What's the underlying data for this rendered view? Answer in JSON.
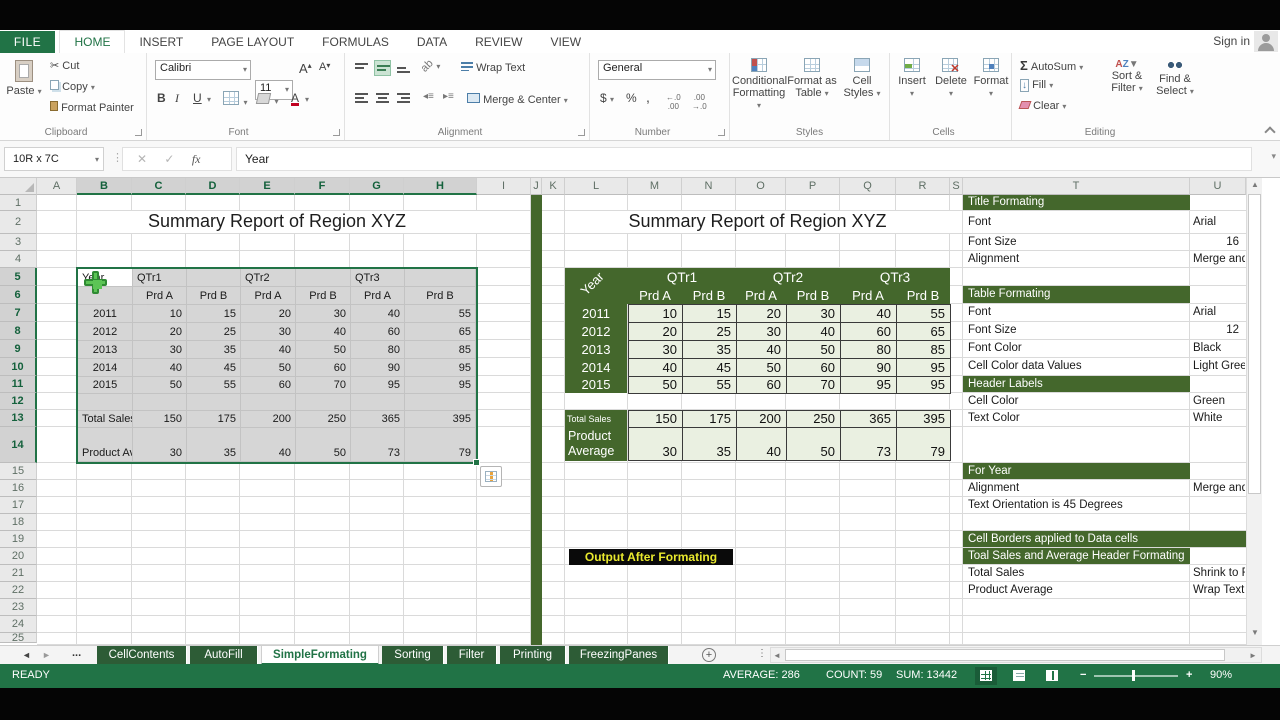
{
  "ribbon_tabs": {
    "file": "FILE",
    "items": [
      "HOME",
      "INSERT",
      "PAGE LAYOUT",
      "FORMULAS",
      "DATA",
      "REVIEW",
      "VIEW"
    ],
    "active": "HOME",
    "sign_in": "Sign in"
  },
  "ribbon": {
    "clipboard": {
      "label": "Clipboard",
      "paste": "Paste",
      "cut": "Cut",
      "copy": "Copy",
      "format_painter": "Format Painter"
    },
    "font": {
      "label": "Font",
      "name": "Calibri",
      "size": "11",
      "bold": "B",
      "italic": "I",
      "underline": "U",
      "grow": "A",
      "shrink": "A",
      "color": "A"
    },
    "alignment": {
      "label": "Alignment",
      "wrap": "Wrap Text",
      "merge": "Merge & Center"
    },
    "number": {
      "label": "Number",
      "format": "General",
      "currency": "$",
      "percent": "%",
      "comma": ",",
      "inc_dec": ".00",
      "dec_dec": ".00"
    },
    "styles": {
      "label": "Styles",
      "conditional_1": "Conditional",
      "conditional_2": "Formatting",
      "format_table_1": "Format as",
      "format_table_2": "Table",
      "cell_styles_1": "Cell",
      "cell_styles_2": "Styles"
    },
    "cells": {
      "label": "Cells",
      "insert": "Insert",
      "delete": "Delete",
      "format": "Format"
    },
    "editing": {
      "label": "Editing",
      "autosum": "AutoSum",
      "fill": "Fill",
      "clear": "Clear",
      "sort_1": "Sort &",
      "sort_2": "Filter",
      "find_1": "Find &",
      "find_2": "Select"
    }
  },
  "formula_bar": {
    "name_box": "10R x 7C",
    "cancel": "✕",
    "enter": "✓",
    "fx": "fx",
    "value": "Year"
  },
  "sheet": {
    "col_headers": [
      "A",
      "B",
      "C",
      "D",
      "E",
      "F",
      "G",
      "H",
      "I",
      "J",
      "K",
      "L",
      "M",
      "N",
      "O",
      "P",
      "Q",
      "R",
      "S",
      "T",
      "U"
    ],
    "row_headers": [
      "1",
      "2",
      "3",
      "4",
      "5",
      "6",
      "7",
      "8",
      "9",
      "10",
      "11",
      "12",
      "13",
      "14",
      "15",
      "16",
      "17",
      "18",
      "19",
      "20",
      "21",
      "22",
      "23",
      "24",
      "25"
    ],
    "selected_cols": [
      "B",
      "C",
      "D",
      "E",
      "F",
      "G",
      "H"
    ],
    "selected_row_start": 5,
    "selected_row_end": 14
  },
  "left_table": {
    "title": "Summary Report of Region XYZ",
    "year_label": "Year",
    "quarters": [
      "QTr1",
      "QTr2",
      "QTr3"
    ],
    "sub_headers": [
      "Prd A",
      "Prd B",
      "Prd A",
      "Prd B",
      "Prd A",
      "Prd B"
    ],
    "years": [
      "2011",
      "2012",
      "2013",
      "2014",
      "2015"
    ],
    "data": [
      [
        10,
        15,
        20,
        30,
        40,
        55
      ],
      [
        20,
        25,
        30,
        40,
        60,
        65
      ],
      [
        30,
        35,
        40,
        50,
        80,
        85
      ],
      [
        40,
        45,
        50,
        60,
        90,
        95
      ],
      [
        50,
        55,
        60,
        70,
        95,
        95
      ]
    ],
    "total_label": "Total Sales",
    "totals": [
      150,
      175,
      200,
      250,
      365,
      395
    ],
    "avg_label": "Product Average",
    "averages": [
      30,
      35,
      40,
      50,
      73,
      79
    ]
  },
  "right_table": {
    "title": "Summary Report of Region XYZ",
    "year_label": "Year",
    "quarters": [
      "QTr1",
      "QTr2",
      "QTr3"
    ],
    "sub_headers": [
      "Prd A",
      "Prd B",
      "Prd A",
      "Prd B",
      "Prd A",
      "Prd B"
    ],
    "years": [
      "2011",
      "2012",
      "2013",
      "2014",
      "2015"
    ],
    "data": [
      [
        10,
        15,
        20,
        30,
        40,
        55
      ],
      [
        20,
        25,
        30,
        40,
        60,
        65
      ],
      [
        30,
        35,
        40,
        50,
        80,
        85
      ],
      [
        40,
        45,
        50,
        60,
        90,
        95
      ],
      [
        50,
        55,
        60,
        70,
        95,
        95
      ]
    ],
    "total_label": "Total Sales",
    "totals": [
      150,
      175,
      200,
      250,
      365,
      395
    ],
    "avg_label_1": "Product",
    "avg_label_2": "Average",
    "averages": [
      30,
      35,
      40,
      50,
      73,
      79
    ]
  },
  "output_label": "Output After Formating",
  "side_panel": {
    "rows": [
      {
        "row": 1,
        "type": "header",
        "label": "Title Formating"
      },
      {
        "row": 2,
        "type": "pair",
        "label": "Font",
        "value": "Arial"
      },
      {
        "row": 3,
        "type": "pair",
        "label": "Font Size",
        "value": "16",
        "num": true
      },
      {
        "row": 4,
        "type": "pair",
        "label": "Alignment",
        "value": "Merge and Center"
      },
      {
        "row": 6,
        "type": "header",
        "label": "Table Formating"
      },
      {
        "row": 7,
        "type": "pair",
        "label": "Font",
        "value": "Arial"
      },
      {
        "row": 8,
        "type": "pair",
        "label": "Font Size",
        "value": "12",
        "num": true
      },
      {
        "row": 9,
        "type": "pair",
        "label": "Font Color",
        "value": "Black"
      },
      {
        "row": 10,
        "type": "pair",
        "label": "Cell Color data Values",
        "value": "Light Green"
      },
      {
        "row": 11,
        "type": "header",
        "label": "Header Labels"
      },
      {
        "row": 12,
        "type": "pair",
        "label": "Cell Color",
        "value": "Green"
      },
      {
        "row": 13,
        "type": "pair",
        "label": "Text Color",
        "value": "White"
      },
      {
        "row": 15,
        "type": "header",
        "label": "For Year"
      },
      {
        "row": 16,
        "type": "pair",
        "label": "Alignment",
        "value": "Merge and Center"
      },
      {
        "row": 17,
        "type": "pair",
        "label": "Text Orientation is 45 Degrees",
        "value": ""
      },
      {
        "row": 19,
        "type": "header-wide",
        "label": "Cell Borders applied to Data cells"
      },
      {
        "row": 20,
        "type": "header",
        "label": "Toal Sales and Average Header Formating"
      },
      {
        "row": 21,
        "type": "pair",
        "label": "Total Sales",
        "value": "Shrink to Fit"
      },
      {
        "row": 22,
        "type": "pair",
        "label": "Product Average",
        "value": "Wrap Text"
      }
    ]
  },
  "sheet_tabs": {
    "nav_left": "◄",
    "nav_right": "►",
    "more": "...",
    "tabs": [
      "CellContents",
      "AutoFill",
      "SimpleFormating",
      "Sorting",
      "Filter",
      "Printing",
      "FreezingPanes"
    ],
    "active": "SimpleFormating",
    "new_sheet": "+"
  },
  "status": {
    "mode": "READY",
    "average": "AVERAGE: 286",
    "count": "COUNT: 59",
    "sum": "SUM: 13442",
    "zoom_level": "90%"
  },
  "colors": {
    "excel_green": "#217346",
    "table_green": "#44672c",
    "light_green": "#eaf0e1",
    "selection_gray": "#d6d6d6",
    "output_bg": "#0a0a0a",
    "output_text": "#e9e92e"
  }
}
